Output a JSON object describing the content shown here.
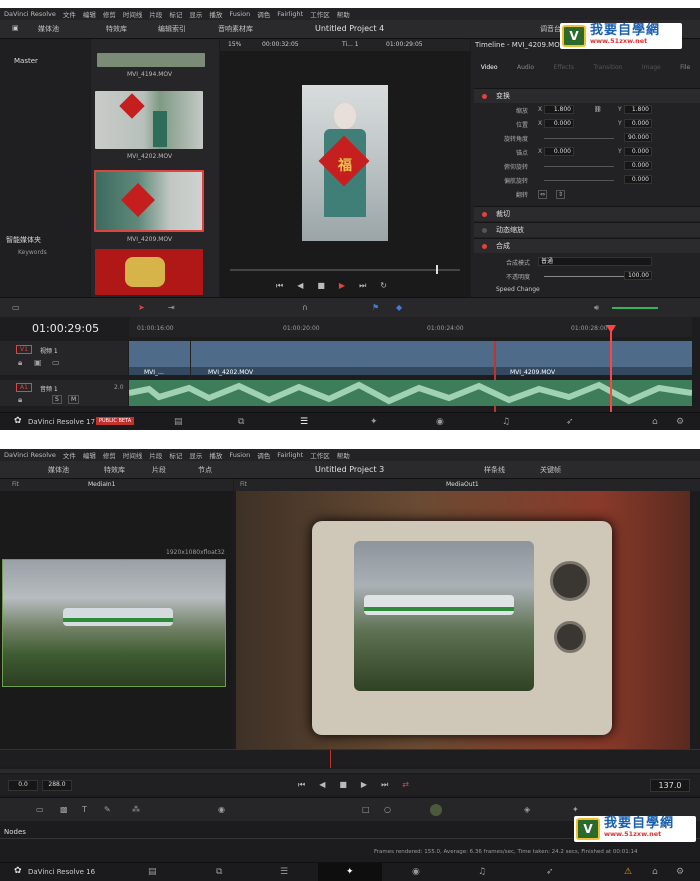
{
  "menu1": [
    "DaVinci Resolve",
    "文件",
    "编辑",
    "修剪",
    "时间线",
    "片段",
    "标记",
    "显示",
    "播放",
    "Fusion",
    "调色",
    "Fairlight",
    "工作区",
    "帮助"
  ],
  "menu2": [
    "DaVinci Resolve",
    "文件",
    "编辑",
    "修剪",
    "时间线",
    "片段",
    "标记",
    "显示",
    "播放",
    "Fusion",
    "调色",
    "Fairlight",
    "工作区",
    "帮助"
  ],
  "s1": {
    "project_title": "Untitled Project 4",
    "toolbar": {
      "media_pool": "媒体池",
      "effects": "特效库",
      "edit_index": "编辑索引",
      "sound_library": "音响素材库",
      "adjust": "调音台"
    },
    "viewer_bar": {
      "zoom": "15%",
      "timecode1": "00:00:32:05",
      "clip": "Ti... 1",
      "timecode2": "01:00:29:05"
    },
    "inspector_title": "Timeline - MVI_4209.MOV",
    "inspector_tabs": [
      "Video",
      "Audio",
      "Effects",
      "Transition",
      "Image",
      "File"
    ],
    "bins": {
      "master": "Master",
      "smart_bins": "智能媒体夹",
      "keywords": "Keywords"
    },
    "clips": [
      {
        "name": "MVI_4194.MOV"
      },
      {
        "name": "MVI_4202.MOV"
      },
      {
        "name": "MVI_4209.MOV"
      }
    ],
    "transform": {
      "header": "变换",
      "zoom_label": "缩放",
      "zoom_x": "1.800",
      "zoom_y": "1.800",
      "pos_label": "位置",
      "pos_x": "0.000",
      "pos_y": "0.000",
      "rot_label": "旋转角度",
      "rot": "90.000",
      "anchor_label": "锚点",
      "anchor_x": "0.000",
      "anchor_y": "0.000",
      "pitch_label": "俯仰旋转",
      "pitch": "0.000",
      "yaw_label": "偏航旋转",
      "yaw": "0.000",
      "flip_label": "翻转"
    },
    "sections": {
      "crop": "裁切",
      "dynamic_zoom": "动态缩放",
      "composite": "合成",
      "composite_mode_label": "合成模式",
      "composite_mode": "普通",
      "opacity_label": "不透明度",
      "opacity": "100.00",
      "speed_change": "Speed Change"
    },
    "timeline": {
      "timecode": "01:00:29:05",
      "ruler": [
        "01:00:16:00",
        "01:00:20:00",
        "01:00:24:00",
        "01:00:28:00"
      ],
      "v1": "V1",
      "v1_name": "视频 1",
      "a1": "A1",
      "a1_name": "音频 1",
      "a1_level": "2.0",
      "video_clips": [
        "MVI_...",
        "MVI_4202.MOV",
        "MVI_4209.MOV"
      ]
    },
    "app_version": "DaVinci Resolve 17",
    "badge": "PUBLIC BETA"
  },
  "s2": {
    "project_title": "Untitled Project 3",
    "toolbar": {
      "media_pool": "媒体池",
      "effects": "特效库",
      "clips": "片段",
      "nodes": "节点",
      "spline": "样条线",
      "keyframes": "关键帧",
      "metadata": "元数据",
      "inspector": "检查器"
    },
    "viewer_left": {
      "fit": "Fit",
      "name": "MediaIn1",
      "res": "1920x1080xfloat32"
    },
    "viewer_right": {
      "fit": "Fit",
      "name": "MediaOut1"
    },
    "frames": {
      "start": "0.0",
      "end": "288.0",
      "current": "137.0"
    },
    "nodes_label": "Nodes",
    "render_status": "Frames rendered: 155.0, Average: 6.36 frames/sec, Time taken: 24.2 secs, Finished at 00:01:14",
    "app_version": "DaVinci Resolve 16"
  },
  "watermark": {
    "text": "我要自學網",
    "url": "www.51zxw.net"
  },
  "colors": {
    "accent_red": "#e0443e",
    "video_track": "#4e6c8a",
    "audio_track": "#3d7d5a",
    "playhead": "#ff4444"
  }
}
